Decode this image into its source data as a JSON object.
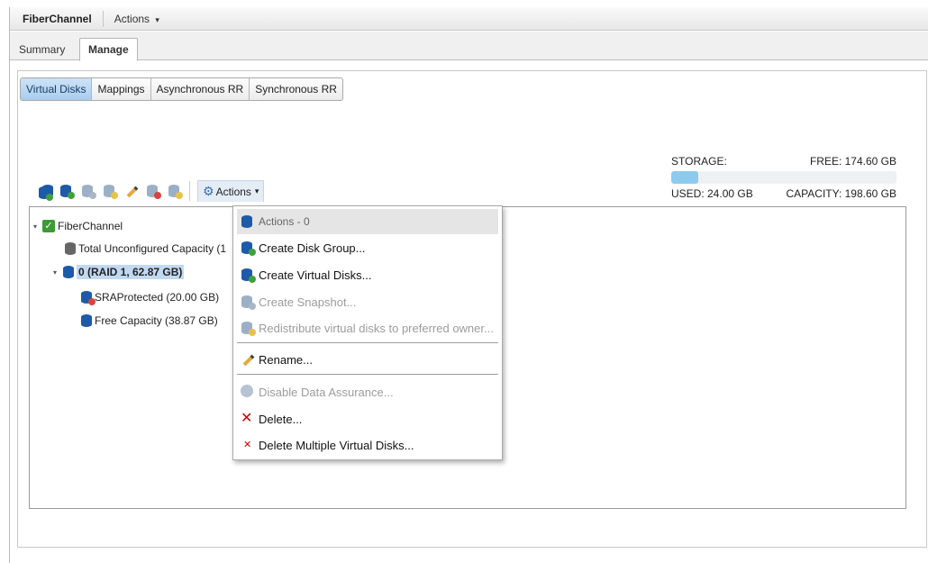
{
  "titlebar": {
    "title": "FiberChannel",
    "actions_label": "Actions",
    "caret": "▾"
  },
  "page_tabs": [
    {
      "label": "Summary"
    },
    {
      "label": "Manage"
    }
  ],
  "sub_tabs": [
    {
      "label": "Virtual Disks"
    },
    {
      "label": "Mappings"
    },
    {
      "label": "Asynchronous RR"
    },
    {
      "label": "Synchronous RR"
    }
  ],
  "storage": {
    "label": "STORAGE:",
    "free": "FREE: 174.60 GB",
    "used": "USED: 24.00 GB",
    "capacity": "CAPACITY: 198.60 GB",
    "used_fraction": 0.121
  },
  "toolbar": {
    "actions_label": "Actions",
    "caret": "▾",
    "icons": [
      "create-disk-group-icon",
      "create-virtual-disks-icon",
      "create-snapshot-icon",
      "redistribute-icon",
      "rename-icon",
      "disable-data-assurance-icon",
      "delete-icon",
      "gear-icon"
    ]
  },
  "tree": {
    "expand_glyph": "▾",
    "root": "FiberChannel",
    "unconfigured": "Total Unconfigured Capacity (1",
    "group": "0 (RAID 1, 62.87 GB)",
    "vdisk": "SRAProtected (20.00 GB)",
    "free": "Free Capacity (38.87 GB)"
  },
  "menu": {
    "header": "Actions - 0",
    "items": [
      {
        "label": "Create Disk Group...",
        "enabled": true
      },
      {
        "label": "Create Virtual Disks...",
        "enabled": true
      },
      {
        "label": "Create Snapshot...",
        "enabled": false
      },
      {
        "label": "Redistribute virtual disks to preferred owner...",
        "enabled": false
      },
      {
        "label": "Rename...",
        "enabled": true
      },
      {
        "label": "Disable Data Assurance...",
        "enabled": false
      },
      {
        "label": "Delete...",
        "enabled": true
      },
      {
        "label": "Delete Multiple Virtual Disks...",
        "enabled": true
      }
    ]
  },
  "colors": {
    "accent": "#8ccbee",
    "selection": "#c2d9f2",
    "active_tab": "#a9cdee"
  }
}
